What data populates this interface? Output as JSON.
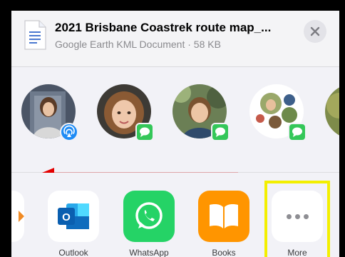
{
  "share_sheet": {
    "file_title": "2021 Brisbane Coastrek route map_...",
    "file_subtitle": "Google Earth KML Document · 58 KB"
  },
  "people": [
    {
      "badge": "airdrop-icon"
    },
    {
      "badge": "messages-icon"
    },
    {
      "badge": "messages-icon"
    },
    {
      "badge": "messages-icon"
    },
    {
      "badge": ""
    }
  ],
  "apps": [
    {
      "label": "Outlook",
      "color": "#0f6cbd"
    },
    {
      "label": "WhatsApp",
      "color": "#25d366"
    },
    {
      "label": "Books",
      "color": "#ff9500"
    },
    {
      "label": "More",
      "color": "#ffffff"
    }
  ],
  "colors": {
    "annotation_arrow": "#e30000",
    "annotation_highlight": "#f3ef00"
  }
}
